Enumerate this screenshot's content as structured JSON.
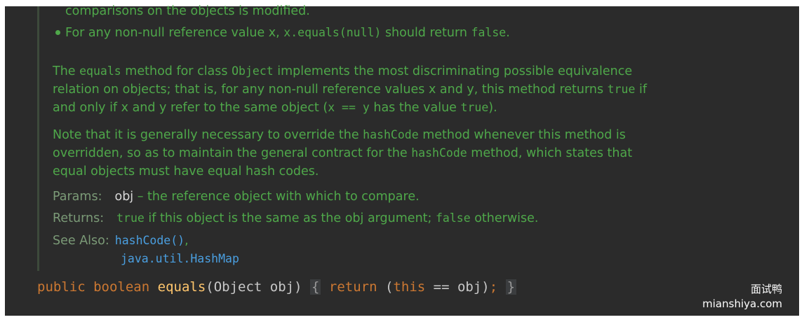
{
  "doc": {
    "cut_line": "comparisons on the objects is modified.",
    "bullet": {
      "pre": "For any non-null reference value x, ",
      "code1": "x.equals(null)",
      "mid": " should return ",
      "code2": "false",
      "post": "."
    },
    "para1": {
      "l1_a": "The ",
      "l1_code1": "equals",
      "l1_b": " method for class ",
      "l1_code2": "Object",
      "l1_c": " implements the most discriminating possible equivalence",
      "l2_a": "relation on objects; that is, for any non-null reference values x and y, this method returns ",
      "l2_code": "true",
      "l2_b": " if",
      "l3_a": "and only if x and y refer to the same object (",
      "l3_code1": "x == y",
      "l3_b": " has the value ",
      "l3_code2": "true",
      "l3_c": ")."
    },
    "para2": {
      "l1_a": "Note that it is generally necessary to override the ",
      "l1_code": "hashCode",
      "l1_b": " method whenever this method is",
      "l2_a": "overridden, so as to maintain the general contract for the ",
      "l2_code": "hashCode",
      "l2_b": " method, which states that",
      "l3": "equal objects must have equal hash codes."
    },
    "params": {
      "label": "Params:",
      "name": "obj",
      "desc": " – the reference object with which to compare."
    },
    "returns": {
      "label": "Returns:",
      "code1": "true",
      "text1": " if this object is the same as the obj argument; ",
      "code2": "false",
      "text2": " otherwise."
    },
    "see_also": {
      "label": "See Also:",
      "link1": "hashCode()",
      "sep": ",",
      "link2": "java.util.HashMap"
    }
  },
  "code": {
    "kw_public": "public",
    "kw_boolean": "boolean",
    "method": "equals",
    "params": "(Object obj)",
    "brace_open": "{",
    "kw_return": "return",
    "paren_open": "(",
    "kw_this": "this",
    "expr": " == obj)",
    "semicolon": ";",
    "brace_close": "}"
  },
  "watermark": {
    "cn": "面试鸭",
    "site": "mianshiya.com"
  },
  "colors": {
    "background": "#2b2b2b",
    "doc_text": "#4fa84a",
    "keyword": "#cc7832",
    "method": "#ffc66d",
    "link": "#4a9fe0"
  }
}
